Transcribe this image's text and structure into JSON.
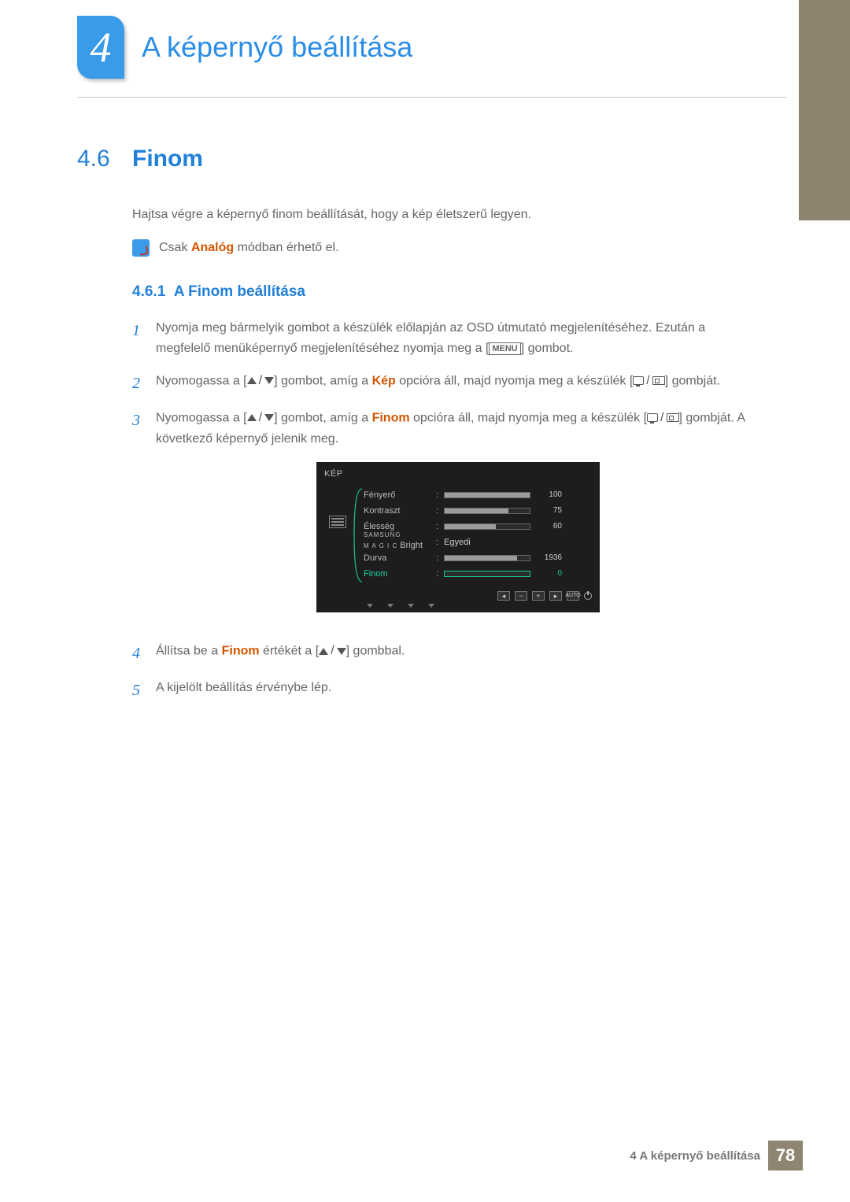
{
  "chapter": {
    "number": "4",
    "title": "A képernyő beállítása"
  },
  "section": {
    "number": "4.6",
    "title": "Finom"
  },
  "intro": "Hajtsa végre a képernyő finom beállítását, hogy a kép életszerű legyen.",
  "note": {
    "pre": "Csak ",
    "hl": "Analóg",
    "post": " módban érhető el."
  },
  "subsection": {
    "number": "4.6.1",
    "title": "A Finom beállítása"
  },
  "menu_label": "MENU",
  "steps": {
    "s1": {
      "num": "1",
      "a": "Nyomja meg bármelyik gombot a készülék előlapján az OSD útmutató megjelenítéséhez. Ezután a megfelelő menüképernyő megjelenítéséhez nyomja meg a [",
      "b": "] gombot."
    },
    "s2": {
      "num": "2",
      "a": "Nyomogassa a [",
      "b": "] gombot, amíg a ",
      "hl": "Kép",
      "c": " opcióra áll, majd nyomja meg a készülék [",
      "d": "] gombját."
    },
    "s3": {
      "num": "3",
      "a": "Nyomogassa a [",
      "b": "] gombot, amíg a ",
      "hl": "Finom",
      "c": " opcióra áll, majd nyomja meg a készülék [",
      "d": "] gombját. A következő képernyő jelenik meg."
    },
    "s4": {
      "num": "4",
      "a": "Állítsa be a ",
      "hl": "Finom",
      "b": " értékét a [",
      "c": "] gombbal."
    },
    "s5": {
      "num": "5",
      "a": "A kijelölt beállítás érvénybe lép."
    }
  },
  "osd": {
    "title": "KÉP",
    "rows": {
      "brightness": {
        "label": "Fényerő",
        "value": "100",
        "fill": 100
      },
      "contrast": {
        "label": "Kontraszt",
        "value": "75",
        "fill": 75
      },
      "sharpness": {
        "label": "Élesség",
        "value": "60",
        "fill": 60
      },
      "magic": {
        "brand": "SAMSUNG",
        "sub": "M A G I C",
        "label": "Bright",
        "value": "Egyedi"
      },
      "coarse": {
        "label": "Durva",
        "value": "1936",
        "fill": 85
      },
      "fine": {
        "label": "Finom",
        "value": "0",
        "fill": 0
      }
    },
    "auto": "AUTO"
  },
  "footer": {
    "text": "4 A képernyő beállítása",
    "page": "78"
  }
}
